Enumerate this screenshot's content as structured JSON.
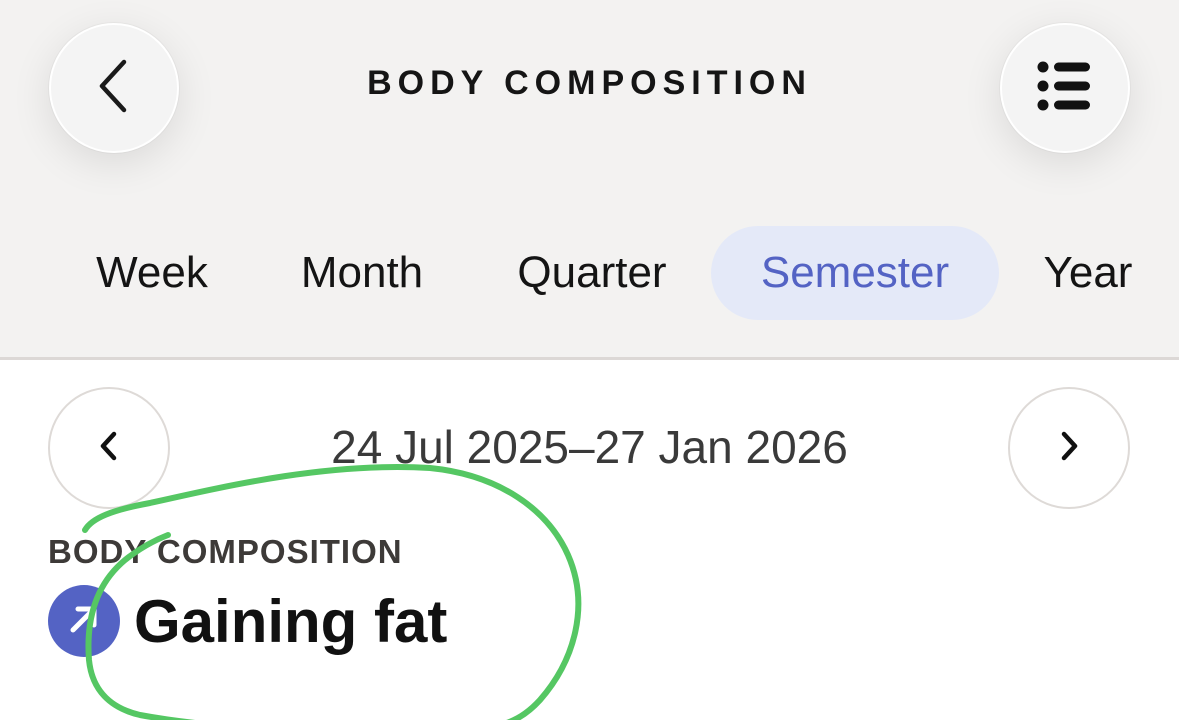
{
  "header": {
    "title": "BODY COMPOSITION",
    "back_icon": "chevron-left-icon",
    "menu_icon": "list-icon"
  },
  "tabs": [
    {
      "label": "Week",
      "active": false
    },
    {
      "label": "Month",
      "active": false
    },
    {
      "label": "Quarter",
      "active": false
    },
    {
      "label": "Semester",
      "active": true
    },
    {
      "label": "Year",
      "active": false
    }
  ],
  "date_nav": {
    "range": "24 Jul 2025–27 Jan 2026",
    "prev_icon": "chevron-left-icon",
    "next_icon": "chevron-right-icon"
  },
  "summary": {
    "label": "BODY COMPOSITION",
    "status": "Gaining fat",
    "trend_icon": "arrow-up-right-icon"
  },
  "colors": {
    "accent": "#5463c4",
    "active_tab_bg": "#e4e9f8",
    "annotation_stroke": "#55c763",
    "top_background": "#f3f2f1"
  }
}
